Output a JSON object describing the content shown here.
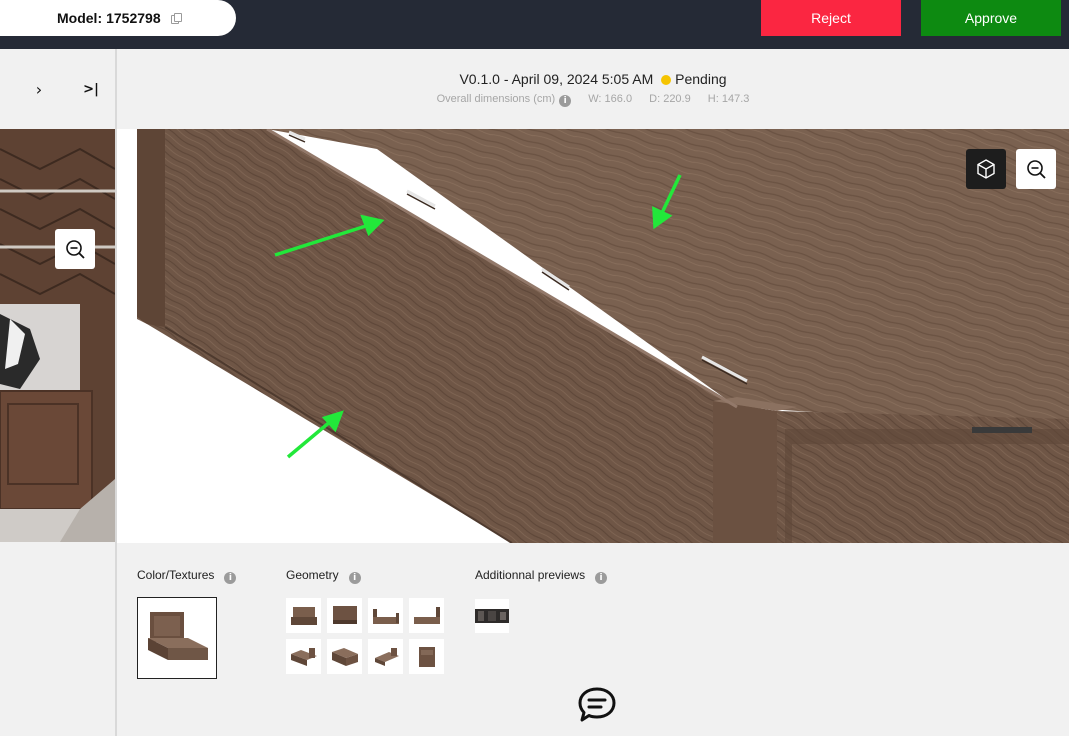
{
  "header": {
    "model_label": "Model:",
    "model_id": "1752798",
    "reject_label": "Reject",
    "approve_label": "Approve"
  },
  "nav": {
    "next_glyph": "›",
    "last_glyph": ">|"
  },
  "version": {
    "text": "V0.1.0 - April 09, 2024 5:05 AM",
    "status": "Pending",
    "status_color": "#f5c400"
  },
  "dimensions": {
    "label": "Overall dimensions (cm)",
    "w": "W: 166.0",
    "d": "D: 220.9",
    "h": "H: 147.3"
  },
  "sections": {
    "color_textures": "Color/Textures",
    "geometry": "Geometry",
    "additional_previews": "Additionnal previews"
  },
  "colors": {
    "reject": "#fb2641",
    "approve": "#0d8a11",
    "topbar": "#252a36",
    "annotation_arrow": "#22e83a"
  },
  "icons": {
    "zoom": "zoom-out-icon",
    "cube": "3d-cube-icon",
    "info": "info-icon",
    "chat": "chat-bubble-icon",
    "copy": "copy-icon"
  }
}
